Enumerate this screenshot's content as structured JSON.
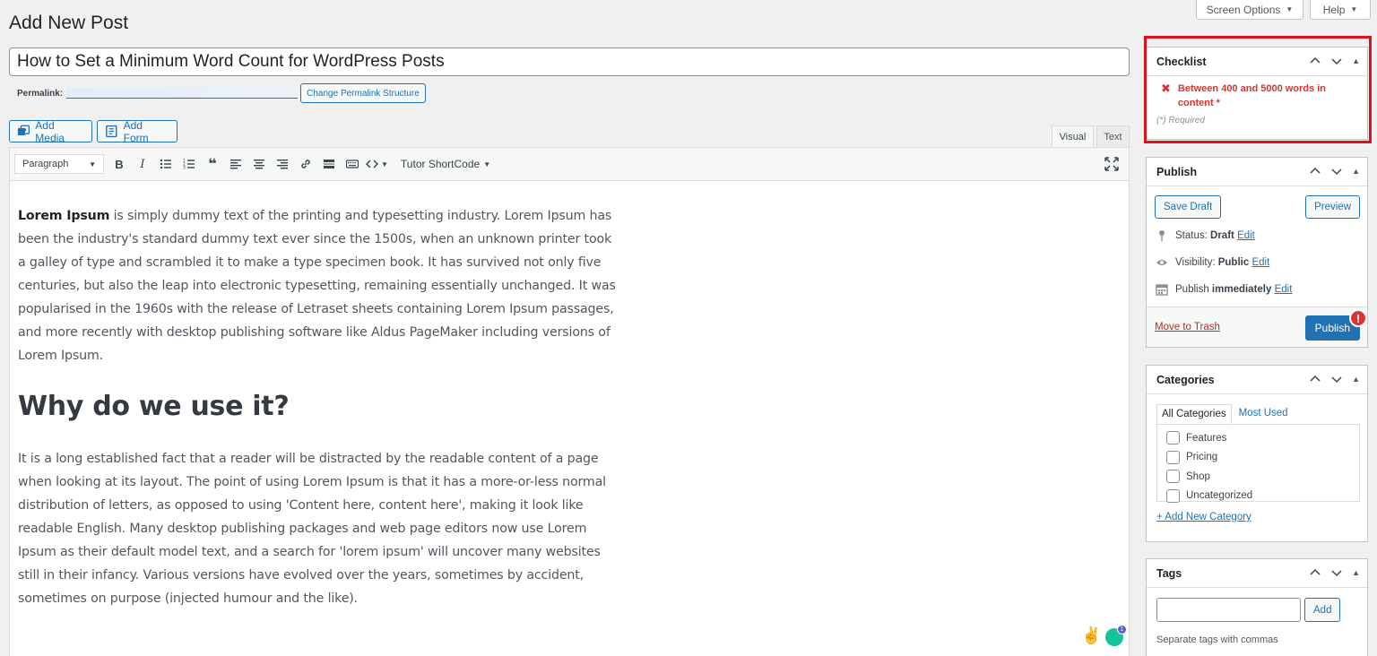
{
  "header": {
    "title": "Add New Post",
    "screen_options": "Screen Options",
    "help": "Help"
  },
  "post": {
    "title": "How to Set a Minimum Word Count for WordPress Posts",
    "permalink_label": "Permalink:",
    "change_permalink": "Change Permalink Structure"
  },
  "media": {
    "add_media": "Add Media",
    "add_form": "Add Form"
  },
  "editor_tabs": {
    "visual": "Visual",
    "text": "Text"
  },
  "toolbar": {
    "format": "Paragraph",
    "shortcode": "Tutor ShortCode"
  },
  "content": {
    "p1_bold": "Lorem Ipsum",
    "p1_rest": " is simply dummy text of the printing and typesetting industry. Lorem Ipsum has been the industry's standard dummy text ever since the 1500s, when an unknown printer took a galley of type and scrambled it to make a type specimen book. It has survived not only five centuries, but also the leap into electronic typesetting, remaining essentially unchanged. It was popularised in the 1960s with the release of Letraset sheets containing Lorem Ipsum passages, and more recently with desktop publishing software like Aldus PageMaker including versions of Lorem Ipsum.",
    "h2": "Why do we use it?",
    "p2": "It is a long established fact that a reader will be distracted by the readable content of a page when looking at its layout. The point of using Lorem Ipsum is that it has a more-or-less normal distribution of letters, as opposed to using 'Content here, content here', making it look like readable English. Many desktop publishing packages and web page editors now use Lorem Ipsum as their default model text, and a search for 'lorem ipsum' will uncover many websites still in their infancy. Various versions have evolved over the years, sometimes by accident, sometimes on purpose (injected humour and the like).",
    "emoji": "✌️",
    "grammarly_count": "1"
  },
  "checklist": {
    "title": "Checklist",
    "item": "Between 400 and 5000 words in content *",
    "required": "(*) Required",
    "highlight_color": "#e0101c"
  },
  "publish": {
    "title": "Publish",
    "save_draft": "Save Draft",
    "preview": "Preview",
    "status_label": "Status:",
    "status_value": "Draft",
    "visibility_label": "Visibility:",
    "visibility_value": "Public",
    "publish_label": "Publish",
    "publish_value": "immediately",
    "edit": "Edit",
    "trash": "Move to Trash",
    "publish_button": "Publish",
    "warning": "!"
  },
  "categories": {
    "title": "Categories",
    "tab_all": "All Categories",
    "tab_most_used": "Most Used",
    "items": [
      "Features",
      "Pricing",
      "Shop",
      "Uncategorized"
    ],
    "add_new": "+ Add New Category"
  },
  "tags": {
    "title": "Tags",
    "add": "Add",
    "note": "Separate tags with commas"
  }
}
